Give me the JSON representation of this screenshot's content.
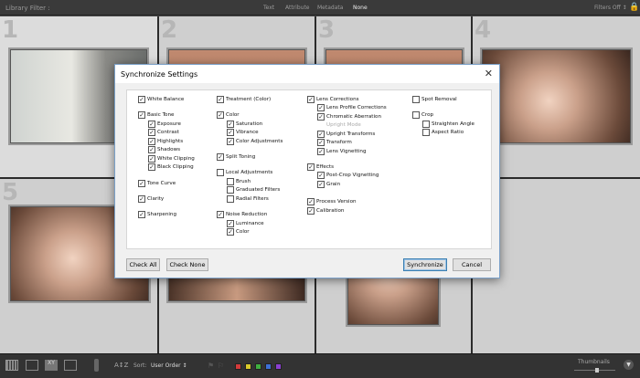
{
  "topbar": {
    "label": "Library Filter :",
    "filters": [
      "Text",
      "Attribute",
      "Metadata",
      "None"
    ],
    "active": "None",
    "filters_off": "Filters Off ↕"
  },
  "grid": {
    "cell_numbers": [
      "1",
      "2",
      "3",
      "4",
      "5"
    ]
  },
  "dialog": {
    "title": "Synchronize Settings",
    "close": "✕",
    "columns": [
      [
        {
          "label": "White Balance",
          "checked": true
        },
        {
          "label": "Basic Tone",
          "checked": true
        },
        {
          "label": "Exposure",
          "checked": true
        },
        {
          "label": "Contrast",
          "checked": true
        },
        {
          "label": "Highlights",
          "checked": true
        },
        {
          "label": "Shadows",
          "checked": true
        },
        {
          "label": "White Clipping",
          "checked": true
        },
        {
          "label": "Black Clipping",
          "checked": true
        },
        {
          "label": "Tone Curve",
          "checked": true
        },
        {
          "label": "Clarity",
          "checked": true
        },
        {
          "label": "Sharpening",
          "checked": true
        }
      ],
      [
        {
          "label": "Treatment (Color)",
          "checked": true
        },
        {
          "label": "Color",
          "checked": true
        },
        {
          "label": "Saturation",
          "checked": true
        },
        {
          "label": "Vibrance",
          "checked": true
        },
        {
          "label": "Color Adjustments",
          "checked": true
        },
        {
          "label": "Split Toning",
          "checked": true
        },
        {
          "label": "Local Adjustments",
          "checked": false
        },
        {
          "label": "Brush",
          "checked": false
        },
        {
          "label": "Graduated Filters",
          "checked": false
        },
        {
          "label": "Radial Filters",
          "checked": false
        },
        {
          "label": "Noise Reduction",
          "checked": true
        },
        {
          "label": "Luminance",
          "checked": true
        },
        {
          "label": "Color",
          "checked": true
        }
      ],
      [
        {
          "label": "Lens Corrections",
          "checked": true
        },
        {
          "label": "Lens Profile Corrections",
          "checked": true
        },
        {
          "label": "Chromatic Aberration",
          "checked": true
        },
        {
          "label": "Upright Mode",
          "checked": true,
          "disabled": true
        },
        {
          "label": "Upright Transforms",
          "checked": true
        },
        {
          "label": "Transform",
          "checked": true
        },
        {
          "label": "Lens Vignetting",
          "checked": true
        },
        {
          "label": "Effects",
          "checked": true
        },
        {
          "label": "Post-Crop Vignetting",
          "checked": true
        },
        {
          "label": "Grain",
          "checked": true
        },
        {
          "label": "Process Version",
          "checked": true
        },
        {
          "label": "Calibration",
          "checked": true
        }
      ],
      [
        {
          "label": "Spot Removal",
          "checked": false
        },
        {
          "label": "Crop",
          "checked": false
        },
        {
          "label": "Straighten Angle",
          "checked": false
        },
        {
          "label": "Aspect Ratio",
          "checked": false
        }
      ]
    ],
    "buttons": {
      "check_all": "Check All",
      "check_none": "Check None",
      "synchronize": "Synchronize",
      "cancel": "Cancel"
    }
  },
  "bottombar": {
    "sort_label": "Sort:",
    "sort_value": "User Order ↕",
    "thumbnails": "Thumbnails",
    "thumbnail_size": 0.55,
    "label_colors": [
      "#d23a3a",
      "#d8c92a",
      "#3fae3f",
      "#3d6fd6",
      "#8a3fd0"
    ]
  }
}
